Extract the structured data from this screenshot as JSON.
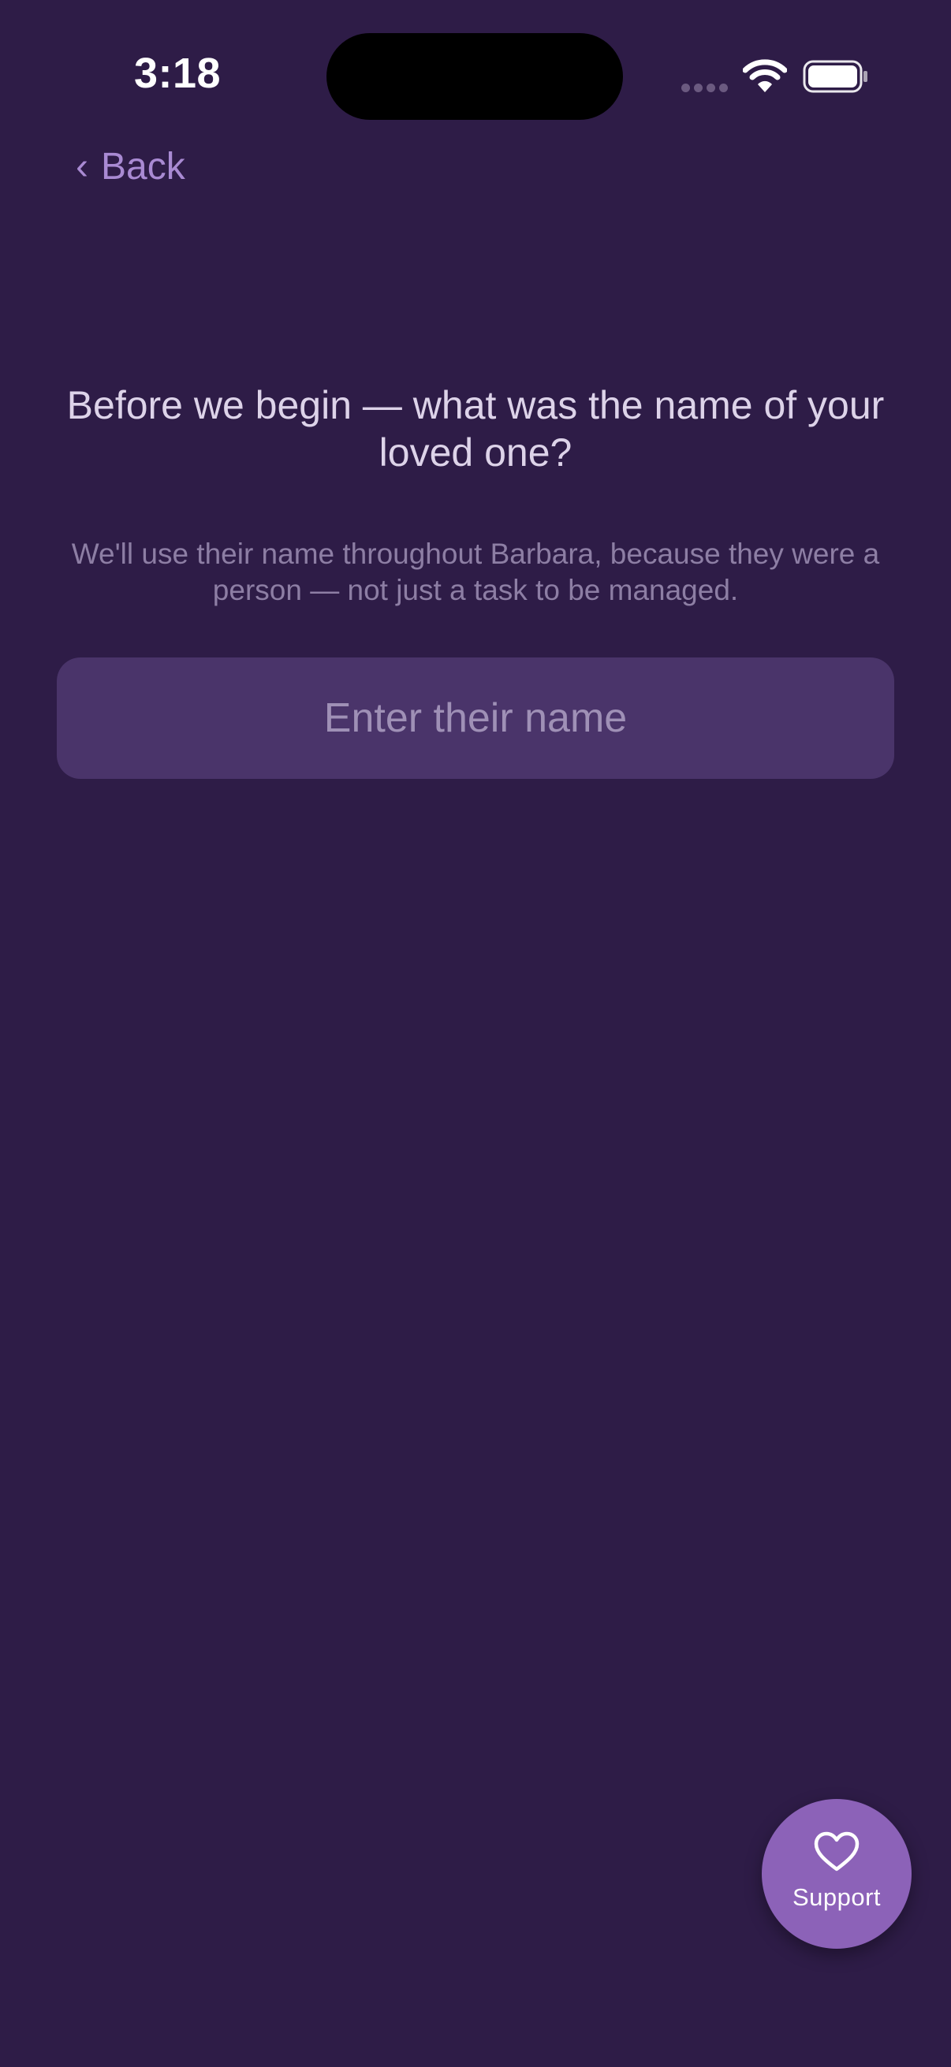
{
  "status_bar": {
    "time": "3:18"
  },
  "nav": {
    "back_label": "Back",
    "back_chevron": "‹"
  },
  "onboarding": {
    "question": "Before we begin — what was the name of your loved one?",
    "subtitle": "We'll use their name throughout Barbara, because they were a person — not just a task to be managed.",
    "name_input": {
      "value": "",
      "placeholder": "Enter their name"
    }
  },
  "support_button": {
    "label": "Support",
    "icon": "heart-icon"
  },
  "colors": {
    "background": "#2e1c47",
    "accent": "#a98ad3",
    "input_bg": "#4a346a",
    "support_bg": "#8c62b8"
  }
}
